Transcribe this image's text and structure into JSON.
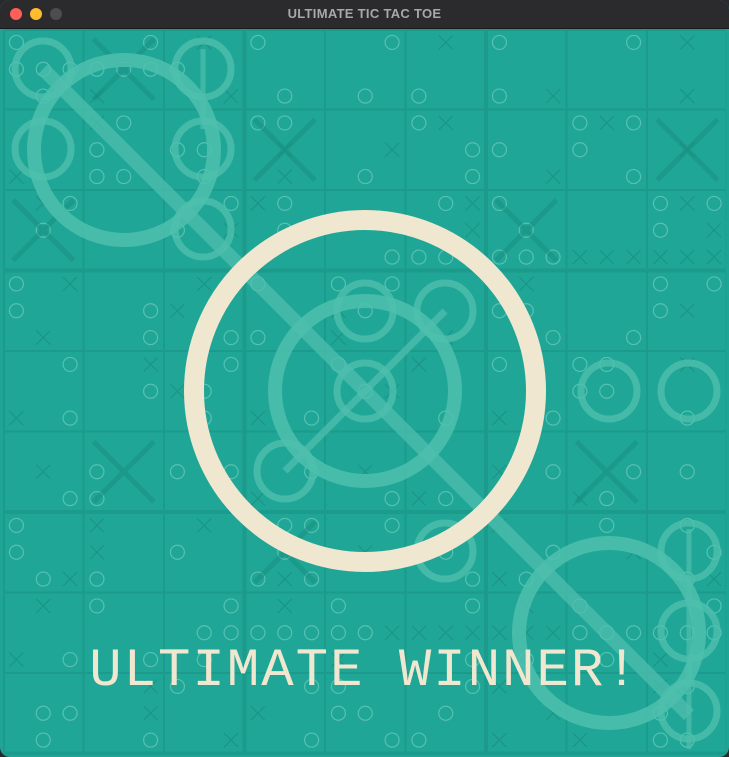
{
  "window": {
    "title": "ULTIMATE TIC TAC TOE"
  },
  "overlay": {
    "message": "ULTIMATE WINNER!",
    "winner_symbol": "O"
  },
  "colors": {
    "background": "#20a696",
    "mark": "#4fbfae",
    "dark_mark": "#178a7c",
    "winner": "#efe7cf"
  }
}
